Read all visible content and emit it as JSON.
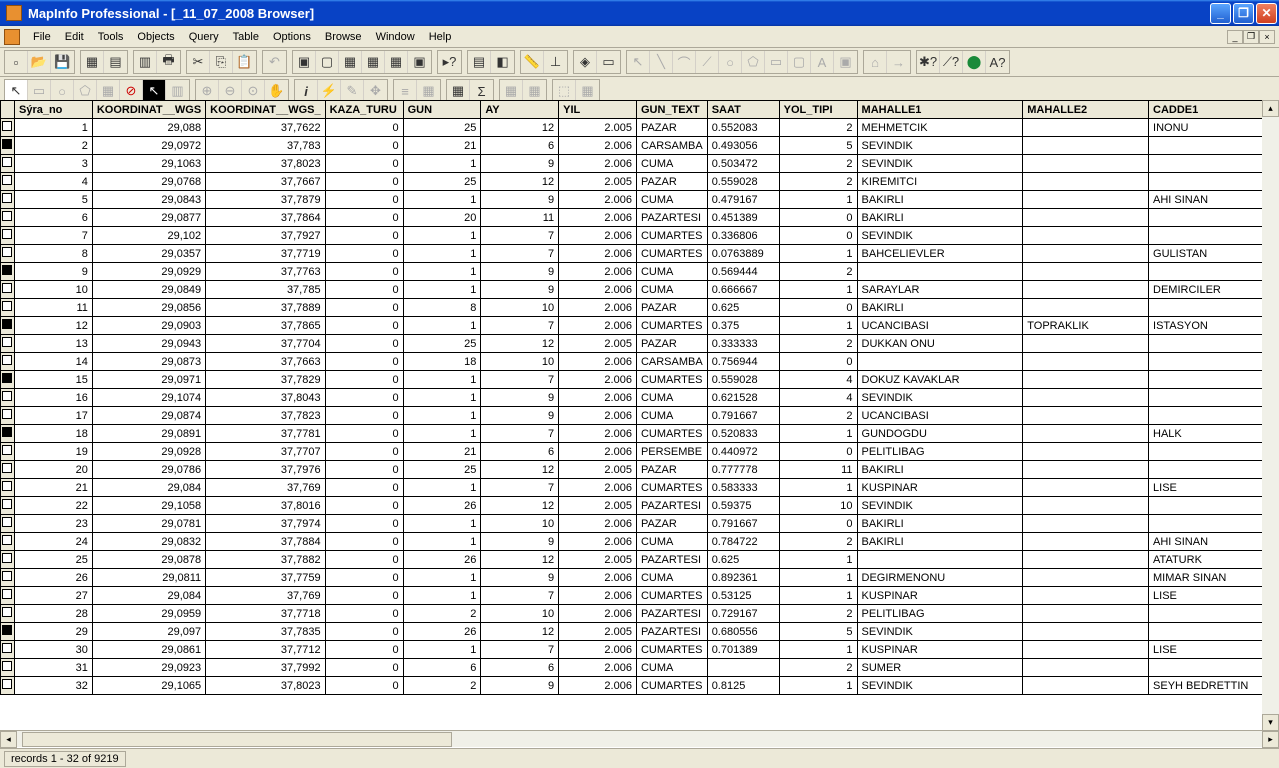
{
  "title": "MapInfo Professional - [_11_07_2008 Browser]",
  "menus": [
    "File",
    "Edit",
    "Tools",
    "Objects",
    "Query",
    "Table",
    "Options",
    "Browse",
    "Window",
    "Help"
  ],
  "status": "records 1 - 32 of 9219",
  "columns": [
    "Sýra_no",
    "KOORDINAT__WGS",
    "KOORDINAT__WGS_",
    "KAZA_TURU",
    "GUN",
    "AY",
    "YIL",
    "GUN_TEXT",
    "SAAT",
    "YOL_TIPI",
    "MAHALLE1",
    "MAHALLE2",
    "CADDE1"
  ],
  "col_classes": [
    "c-syra",
    "c-k1",
    "c-k2",
    "c-kaza",
    "c-gun",
    "c-ay",
    "c-yil",
    "c-gtext",
    "c-saat",
    "c-yol",
    "c-m1",
    "c-m2",
    "c-cadde"
  ],
  "selected_rows": [
    2,
    9,
    12,
    15,
    18,
    29
  ],
  "rows": [
    {
      "c": [
        "1",
        "29,088",
        "37,7622",
        "0",
        "25",
        "12",
        "2.005",
        "PAZAR",
        "0.552083",
        "2",
        "MEHMETCIK",
        "",
        "INONU"
      ]
    },
    {
      "c": [
        "2",
        "29,0972",
        "37,783",
        "0",
        "21",
        "6",
        "2.006",
        "CARSAMBA",
        "0.493056",
        "5",
        "SEVINDIK",
        "",
        ""
      ]
    },
    {
      "c": [
        "3",
        "29,1063",
        "37,8023",
        "0",
        "1",
        "9",
        "2.006",
        "CUMA",
        "0.503472",
        "2",
        "SEVINDIK",
        "",
        ""
      ]
    },
    {
      "c": [
        "4",
        "29,0768",
        "37,7667",
        "0",
        "25",
        "12",
        "2.005",
        "PAZAR",
        "0.559028",
        "2",
        "KIREMITCI",
        "",
        ""
      ]
    },
    {
      "c": [
        "5",
        "29,0843",
        "37,7879",
        "0",
        "1",
        "9",
        "2.006",
        "CUMA",
        "0.479167",
        "1",
        "BAKIRLI",
        "",
        "AHI SINAN"
      ]
    },
    {
      "c": [
        "6",
        "29,0877",
        "37,7864",
        "0",
        "20",
        "11",
        "2.006",
        "PAZARTESI",
        "0.451389",
        "0",
        "BAKIRLI",
        "",
        ""
      ]
    },
    {
      "c": [
        "7",
        "29,102",
        "37,7927",
        "0",
        "1",
        "7",
        "2.006",
        "CUMARTES",
        "0.336806",
        "0",
        "SEVINDIK",
        "",
        ""
      ]
    },
    {
      "c": [
        "8",
        "29,0357",
        "37,7719",
        "0",
        "1",
        "7",
        "2.006",
        "CUMARTES",
        "0.0763889",
        "1",
        "BAHCELIEVLER",
        "",
        "GULISTAN"
      ]
    },
    {
      "c": [
        "9",
        "29,0929",
        "37,7763",
        "0",
        "1",
        "9",
        "2.006",
        "CUMA",
        "0.569444",
        "2",
        "",
        "",
        ""
      ]
    },
    {
      "c": [
        "10",
        "29,0849",
        "37,785",
        "0",
        "1",
        "9",
        "2.006",
        "CUMA",
        "0.666667",
        "1",
        "SARAYLAR",
        "",
        "DEMIRCILER"
      ]
    },
    {
      "c": [
        "11",
        "29,0856",
        "37,7889",
        "0",
        "8",
        "10",
        "2.006",
        "PAZAR",
        "0.625",
        "0",
        "BAKIRLI",
        "",
        ""
      ]
    },
    {
      "c": [
        "12",
        "29,0903",
        "37,7865",
        "0",
        "1",
        "7",
        "2.006",
        "CUMARTES",
        "0.375",
        "1",
        "UCANCIBASI",
        "TOPRAKLIK",
        "ISTASYON"
      ]
    },
    {
      "c": [
        "13",
        "29,0943",
        "37,7704",
        "0",
        "25",
        "12",
        "2.005",
        "PAZAR",
        "0.333333",
        "2",
        "DUKKAN ONU",
        "",
        ""
      ]
    },
    {
      "c": [
        "14",
        "29,0873",
        "37,7663",
        "0",
        "18",
        "10",
        "2.006",
        "CARSAMBA",
        "0.756944",
        "0",
        "",
        "",
        ""
      ]
    },
    {
      "c": [
        "15",
        "29,0971",
        "37,7829",
        "0",
        "1",
        "7",
        "2.006",
        "CUMARTES",
        "0.559028",
        "4",
        "DOKUZ KAVAKLAR",
        "",
        ""
      ]
    },
    {
      "c": [
        "16",
        "29,1074",
        "37,8043",
        "0",
        "1",
        "9",
        "2.006",
        "CUMA",
        "0.621528",
        "4",
        "SEVINDIK",
        "",
        ""
      ]
    },
    {
      "c": [
        "17",
        "29,0874",
        "37,7823",
        "0",
        "1",
        "9",
        "2.006",
        "CUMA",
        "0.791667",
        "2",
        "UCANCIBASI",
        "",
        ""
      ]
    },
    {
      "c": [
        "18",
        "29,0891",
        "37,7781",
        "0",
        "1",
        "7",
        "2.006",
        "CUMARTES",
        "0.520833",
        "1",
        "GUNDOGDU",
        "",
        "HALK"
      ]
    },
    {
      "c": [
        "19",
        "29,0928",
        "37,7707",
        "0",
        "21",
        "6",
        "2.006",
        "PERSEMBE",
        "0.440972",
        "0",
        "PELITLIBAG",
        "",
        ""
      ]
    },
    {
      "c": [
        "20",
        "29,0786",
        "37,7976",
        "0",
        "25",
        "12",
        "2.005",
        "PAZAR",
        "0.777778",
        "11",
        "BAKIRLI",
        "",
        ""
      ]
    },
    {
      "c": [
        "21",
        "29,084",
        "37,769",
        "0",
        "1",
        "7",
        "2.006",
        "CUMARTES",
        "0.583333",
        "1",
        "KUSPINAR",
        "",
        "LISE"
      ]
    },
    {
      "c": [
        "22",
        "29,1058",
        "37,8016",
        "0",
        "26",
        "12",
        "2.005",
        "PAZARTESI",
        "0.59375",
        "10",
        "SEVINDIK",
        "",
        ""
      ]
    },
    {
      "c": [
        "23",
        "29,0781",
        "37,7974",
        "0",
        "1",
        "10",
        "2.006",
        "PAZAR",
        "0.791667",
        "0",
        "BAKIRLI",
        "",
        ""
      ]
    },
    {
      "c": [
        "24",
        "29,0832",
        "37,7884",
        "0",
        "1",
        "9",
        "2.006",
        "CUMA",
        "0.784722",
        "2",
        "BAKIRLI",
        "",
        "AHI SINAN"
      ]
    },
    {
      "c": [
        "25",
        "29,0878",
        "37,7882",
        "0",
        "26",
        "12",
        "2.005",
        "PAZARTESI",
        "0.625",
        "1",
        "",
        "",
        "ATATURK"
      ]
    },
    {
      "c": [
        "26",
        "29,0811",
        "37,7759",
        "0",
        "1",
        "9",
        "2.006",
        "CUMA",
        "0.892361",
        "1",
        "DEGIRMENONU",
        "",
        "MIMAR SINAN"
      ]
    },
    {
      "c": [
        "27",
        "29,084",
        "37,769",
        "0",
        "1",
        "7",
        "2.006",
        "CUMARTES",
        "0.53125",
        "1",
        "KUSPINAR",
        "",
        "LISE"
      ]
    },
    {
      "c": [
        "28",
        "29,0959",
        "37,7718",
        "0",
        "2",
        "10",
        "2.006",
        "PAZARTESI",
        "0.729167",
        "2",
        "PELITLIBAG",
        "",
        ""
      ]
    },
    {
      "c": [
        "29",
        "29,097",
        "37,7835",
        "0",
        "26",
        "12",
        "2.005",
        "PAZARTESI",
        "0.680556",
        "5",
        "SEVINDIK",
        "",
        ""
      ]
    },
    {
      "c": [
        "30",
        "29,0861",
        "37,7712",
        "0",
        "1",
        "7",
        "2.006",
        "CUMARTES",
        "0.701389",
        "1",
        "KUSPINAR",
        "",
        "LISE"
      ]
    },
    {
      "c": [
        "31",
        "29,0923",
        "37,7992",
        "0",
        "6",
        "6",
        "2.006",
        "CUMA",
        "",
        "2",
        "SUMER",
        "",
        ""
      ]
    },
    {
      "c": [
        "32",
        "29,1065",
        "37,8023",
        "0",
        "2",
        "9",
        "2.006",
        "CUMARTES",
        "0.8125",
        "1",
        "SEVINDIK",
        "",
        "SEYH BEDRETTIN"
      ]
    }
  ],
  "numeric_cols": [
    0,
    1,
    2,
    3,
    4,
    5,
    6,
    9
  ]
}
